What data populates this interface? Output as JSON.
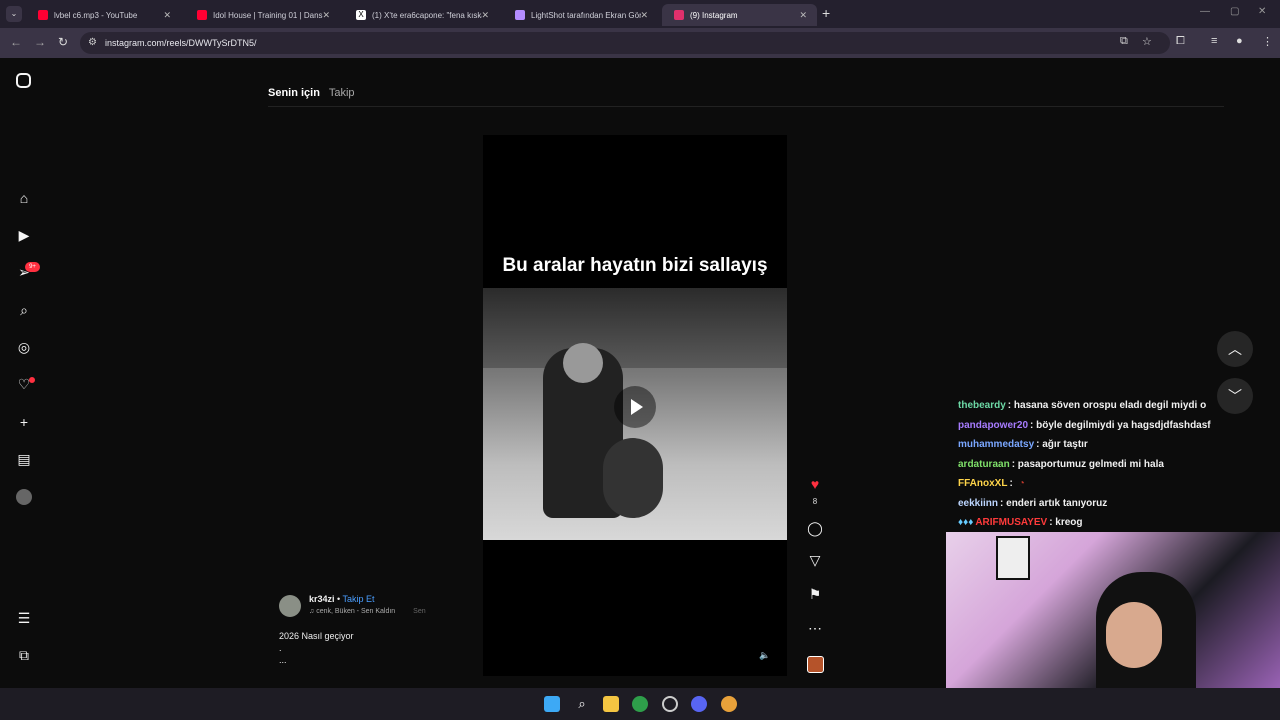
{
  "browser": {
    "tabs": [
      {
        "title": "lvbel c6.mp3 - YouTube",
        "favicon_color": "#ff0033",
        "active": false
      },
      {
        "title": "Idol House | Training 01 | Dans...",
        "favicon_color": "#ff0033",
        "active": false
      },
      {
        "title": "(1) X'te era6capone: \"fena kıska...",
        "favicon_color": "#ffffff",
        "active": false
      },
      {
        "title": "LightShot tarafından Ekran Gör...",
        "favicon_color": "#b38cff",
        "active": false
      },
      {
        "title": "(9) Instagram",
        "favicon_color": "#e1306c",
        "active": true
      }
    ],
    "url": "instagram.com/reels/DWWTySrDTN5/"
  },
  "feed": {
    "tab_for_you": "Senin için",
    "tab_following": "Takip"
  },
  "sidebar": {
    "notification_badge": "9+"
  },
  "reel": {
    "caption": "Bu aralar hayatın bizi sallayış",
    "likes": "8",
    "author": "kr34zi",
    "separator": "•",
    "follow": "Takip Et",
    "music": "cenk, Büken - Sen Kaldın",
    "music_extra": "Sen",
    "description_line1": "2026 Nasıl geçiyor",
    "description_line2": ".",
    "description_more": "..."
  },
  "chat": [
    {
      "user": "thebeardy",
      "color": "#6dd9a6",
      "message": ": hasana söven orospu eladı degil miydi o"
    },
    {
      "user": "pandapower20",
      "color": "#a77cff",
      "message": ": böyle degilmiydi ya hagsdjdfashdasf"
    },
    {
      "user": "muhammedatsy",
      "color": "#7aa7ff",
      "message": ": ağır taştır"
    },
    {
      "user": "ardaturaan",
      "color": "#7fe06a",
      "message": ": pasaportumuz gelmedi mi hala"
    },
    {
      "user": "FFAnoxXL",
      "color": "#ffd54a",
      "message": ":"
    },
    {
      "user": "eekkiinn",
      "color": "#bdd6ff",
      "message": ": enderi artık tanıyoruz"
    },
    {
      "user": "ARIFMUSAYEV",
      "color": "#ff3b3b",
      "message": ": kreog"
    }
  ]
}
